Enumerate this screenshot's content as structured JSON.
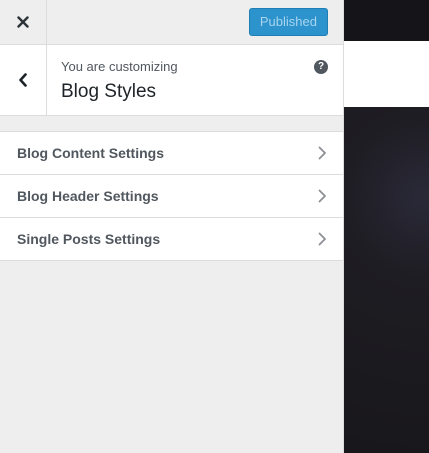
{
  "topbar": {
    "close_icon": "close-icon",
    "publish_label": "Published",
    "publish_color": "#2c93cd"
  },
  "section": {
    "back_icon": "chevron-left-icon",
    "customizing_label": "You are customizing",
    "title": "Blog Styles",
    "help_icon": "question-circle-icon"
  },
  "panels": [
    {
      "label": "Blog Content Settings",
      "icon": "chevron-right-icon"
    },
    {
      "label": "Blog Header Settings",
      "icon": "chevron-right-icon"
    },
    {
      "label": "Single Posts Settings",
      "icon": "chevron-right-icon"
    }
  ],
  "preview": {
    "background": "#1b1a1e"
  }
}
